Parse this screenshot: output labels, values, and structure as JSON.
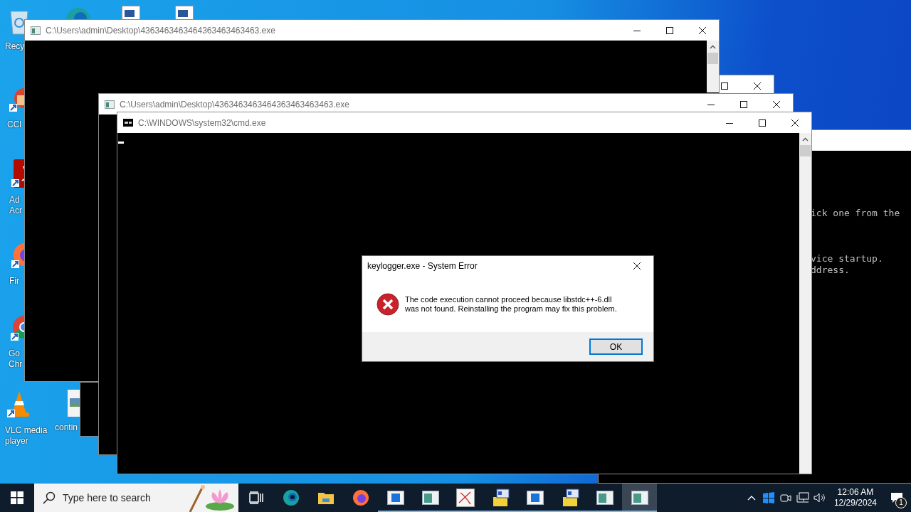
{
  "desktop": {
    "icons": [
      {
        "kind": "recycle",
        "lines": [
          "Recy"
        ]
      },
      {
        "kind": "ccleaner",
        "lines": [
          "CCl"
        ]
      },
      {
        "kind": "acrobat",
        "lines": [
          "Ad",
          "Acr"
        ]
      },
      {
        "kind": "firefox",
        "lines": [
          "Fir"
        ]
      },
      {
        "kind": "chrome",
        "lines": [
          "Go",
          "Chr"
        ]
      },
      {
        "kind": "vlc",
        "lines": [
          "VLC media",
          "player"
        ]
      },
      {
        "kind": "image",
        "lines": [
          "contin"
        ]
      },
      {
        "kind": "edge"
      },
      {
        "kind": "document"
      },
      {
        "kind": "document"
      }
    ]
  },
  "windows": [
    {
      "kind": "console",
      "lines": [
        "ick one from the",
        "vice startup.",
        "ddress."
      ]
    },
    {
      "kind": "console"
    },
    {
      "kind": "console",
      "title": "C:\\Users\\admin\\Desktop\\4363463463464363463463463.exe",
      "scrollbar": true
    },
    {
      "kind": "blank"
    },
    {
      "kind": "console",
      "title": "C:\\Users\\admin\\Desktop\\4363463463464363463463463.exe"
    },
    {
      "kind": "cmd",
      "title": "C:\\WINDOWS\\system32\\cmd.exe",
      "scrollbar": true,
      "cursor": true
    }
  ],
  "dialog": {
    "title": "keylogger.exe - System Error",
    "message": [
      "The code execution cannot proceed because libstdc++-6.dll",
      "was not found. Reinstalling the program may fix this problem."
    ],
    "button": "OK"
  },
  "taskbar": {
    "search": {
      "placeholder": "Type here to search"
    },
    "apps": [
      {
        "kind": "taskview",
        "running": false,
        "selected": false
      },
      {
        "kind": "edge",
        "running": false,
        "selected": false
      },
      {
        "kind": "explorer",
        "running": false,
        "selected": false
      },
      {
        "kind": "firefox",
        "running": false,
        "selected": false
      },
      {
        "kind": "window",
        "running": true,
        "selected": false
      },
      {
        "kind": "console",
        "running": true,
        "selected": false
      },
      {
        "kind": "paint",
        "running": true,
        "selected": false
      },
      {
        "kind": "installer",
        "running": true,
        "selected": false
      },
      {
        "kind": "window",
        "running": true,
        "selected": false
      },
      {
        "kind": "installer",
        "running": true,
        "selected": false
      },
      {
        "kind": "console",
        "running": true,
        "selected": false
      },
      {
        "kind": "console",
        "running": true,
        "selected": true
      }
    ],
    "time": "12:06 AM",
    "date": "12/29/2024",
    "notifications": "1"
  }
}
